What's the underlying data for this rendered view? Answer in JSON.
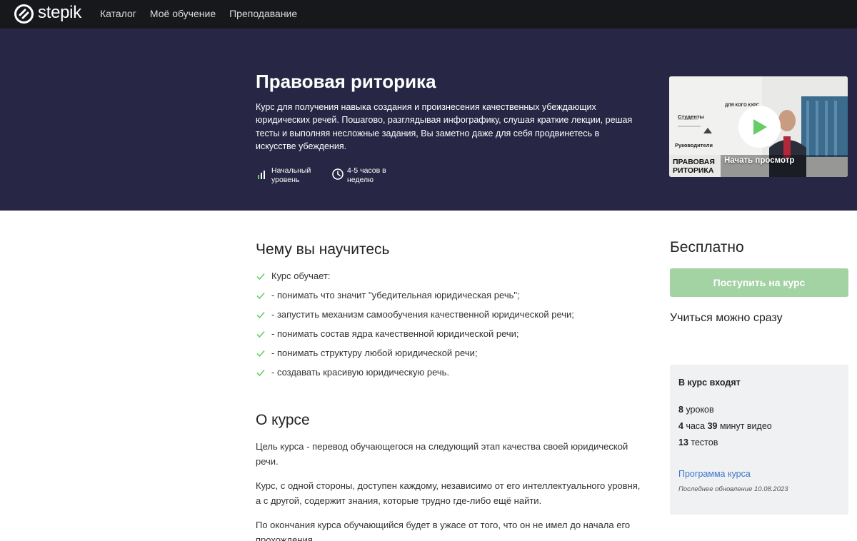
{
  "nav": {
    "logo_text": "stepik",
    "links": [
      "Каталог",
      "Моё обучение",
      "Преподавание"
    ]
  },
  "hero": {
    "title": "Правовая риторика",
    "description": "Курс для получения навыка создания и произнесения качественных убеждающих юридических речей. Пошагово, разглядывая инфографику, слушая краткие лекции, решая тесты и выполняя несложные задания, Вы заметно даже для себя продвинетесь в искусстве убеждения.",
    "level": "Начальный\nуровень",
    "time": "4-5 часов в\nнеделю",
    "video_caption": "Начать просмотр",
    "video_brand": "ПРАВОВАЯ\nРИТОРИКА",
    "video_labels": {
      "students": "Студенты",
      "managers": "Руководители",
      "for_whom": "ДЛЯ КОГО КУРС"
    }
  },
  "learn": {
    "title": "Чему вы научитесь",
    "items": [
      "Курс обучает:",
      "- понимать что значит \"убедительная юридическая речь\";",
      "- запустить механизм самообучения качественной юридической речи;",
      "- понимать состав ядра качественной юридической речи;",
      "- понимать структуру любой юридической речи;",
      "- создавать красивую юридическую речь."
    ]
  },
  "about": {
    "title": "О курсе",
    "paragraphs": [
      "Цель курса - перевод обучающегося на следующий этап качества своей юридической речи.",
      "Курс, с одной стороны, доступен каждому, независимо от его интеллектуального уровня, а с другой, содержит знания, которые трудно где-либо ещё найти.",
      "По окончания курса обучающийся будет в ужасе от того, что он не имел до начала его прохождения."
    ]
  },
  "sidebar": {
    "price": "Бесплатно",
    "enroll_label": "Поступить на курс",
    "instant": "Учиться можно сразу",
    "includes_title": "В курс входят",
    "lessons_num": "8",
    "lessons_label": "уроков",
    "hours_num": "4",
    "hours_label": "часа",
    "minutes_num": "39",
    "minutes_label": "минут видео",
    "tests_num": "13",
    "tests_label": "тестов",
    "program_link": "Программа курса",
    "updated": "Последнее обновление 10.08.2023"
  },
  "colors": {
    "nav_bg": "#17181b",
    "hero_bg": "#272745",
    "accent_green": "#66cc66",
    "button_disabled": "#a3d2a3",
    "link_blue": "#3a76c9"
  }
}
